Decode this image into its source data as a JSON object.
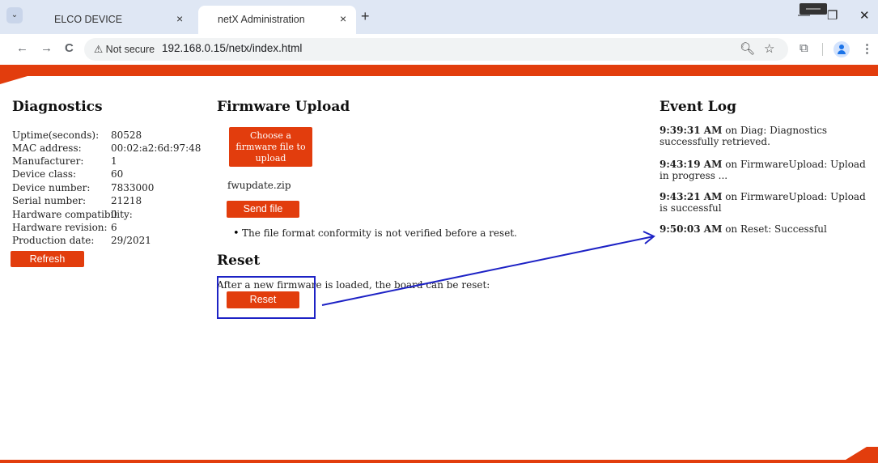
{
  "browser": {
    "tabs": [
      {
        "title": "ELCO DEVICE",
        "close": "×"
      },
      {
        "title": "netX Administration",
        "close": "×"
      }
    ],
    "new_tab": "+",
    "dropdown": "⌄",
    "window_controls": {
      "minimize": "—",
      "restore": "❐",
      "close": "✕"
    },
    "nav": {
      "back": "←",
      "forward": "→",
      "reload": "C"
    },
    "security_label": "⚠ Not secure",
    "url": "192.168.0.15/netx/index.html",
    "icons": [
      "zoom-icon",
      "star-icon",
      "extensions-icon",
      "profile-icon",
      "menu-icon"
    ]
  },
  "diagnostics": {
    "title": "Diagnostics",
    "rows": [
      {
        "label": "Uptime(seconds):",
        "value": "80528"
      },
      {
        "label": "MAC address:",
        "value": "00:02:a2:6d:97:48"
      },
      {
        "label": "Manufacturer:",
        "value": "1"
      },
      {
        "label": "Device class:",
        "value": "60"
      },
      {
        "label": "Device number:",
        "value": "7833000"
      },
      {
        "label": "Serial number:",
        "value": "21218"
      },
      {
        "label": "Hardware compatibility:",
        "value": "0"
      },
      {
        "label": "Hardware revision:",
        "value": "6"
      },
      {
        "label": "Production date:",
        "value": "29/2021"
      }
    ],
    "refresh_label": "Refresh"
  },
  "firmware": {
    "title": "Firmware Upload",
    "choose_line1": "Choose a",
    "choose_line2": "firmware file to",
    "choose_line3": "upload",
    "filename": "fwupdate.zip",
    "send_label": "Send file",
    "note": "The file format conformity is not verified before a reset."
  },
  "reset": {
    "title": "Reset",
    "description": "After a new firmware is loaded, the board can be reset:",
    "button_label": "Reset"
  },
  "event_log": {
    "title": "Event Log",
    "entries": [
      {
        "time": "9:39:31 AM",
        "text": " on Diag: Diagnostics successfully retrieved."
      },
      {
        "time": "9:43:19 AM",
        "text": " on FirmwareUpload: Upload in progress ..."
      },
      {
        "time": "9:43:21 AM",
        "text": " on FirmwareUpload: Upload is successful"
      },
      {
        "time": "9:50:03 AM",
        "text": " on Reset: Successful"
      }
    ]
  },
  "colors": {
    "brand": "#e23d0d",
    "annotation": "#1d22c5"
  }
}
